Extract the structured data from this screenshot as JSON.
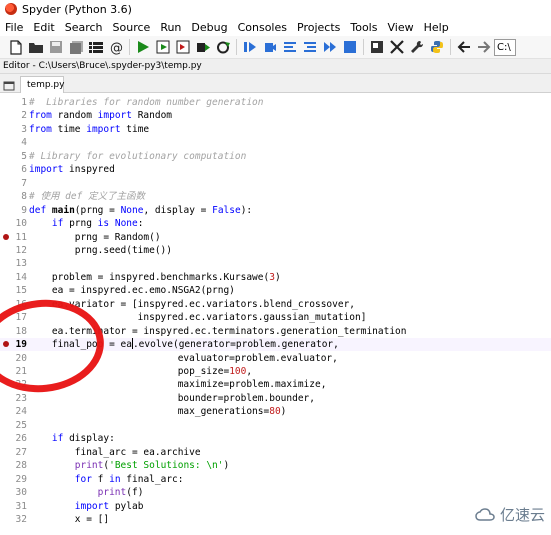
{
  "window": {
    "title": "Spyder (Python 3.6)"
  },
  "menu": [
    "File",
    "Edit",
    "Search",
    "Source",
    "Run",
    "Debug",
    "Consoles",
    "Projects",
    "Tools",
    "View",
    "Help"
  ],
  "toolbar": {
    "path_text": "C:\\"
  },
  "editor": {
    "label": "Editor - C:\\Users\\Bruce\\.spyder-py3\\temp.py",
    "tab_name": "temp.py",
    "current_line": 19,
    "lines": [
      {
        "n": "1",
        "text": "#  Libraries for random number generation"
      },
      {
        "n": "2",
        "text": "from random import Random"
      },
      {
        "n": "3",
        "text": "from time import time"
      },
      {
        "n": "4",
        "text": ""
      },
      {
        "n": "5",
        "text": "# Library for evolutionary computation"
      },
      {
        "n": "6",
        "text": "import inspyred"
      },
      {
        "n": "7",
        "text": ""
      },
      {
        "n": "8",
        "text": "# 使用 def 定义了主函数"
      },
      {
        "n": "9",
        "text": "def main(prng = None, display = False):"
      },
      {
        "n": "10",
        "text": "    if prng is None:"
      },
      {
        "n": "11",
        "text": "        prng = Random()",
        "bp": true
      },
      {
        "n": "12",
        "text": "        prng.seed(time())"
      },
      {
        "n": "13",
        "text": ""
      },
      {
        "n": "14",
        "text": "    problem = inspyred.benchmarks.Kursawe(3)"
      },
      {
        "n": "15",
        "text": "    ea = inspyred.ec.emo.NSGA2(prng)"
      },
      {
        "n": "16",
        "text": "    ea.variator = [inspyred.ec.variators.blend_crossover,"
      },
      {
        "n": "17",
        "text": "                   inspyred.ec.variators.gaussian_mutation]"
      },
      {
        "n": "18",
        "text": "    ea.terminator = inspyred.ec.terminators.generation_termination"
      },
      {
        "n": "19",
        "text": "    final_pop = ea.evolve(generator=problem.generator,",
        "bp": true
      },
      {
        "n": "20",
        "text": "                          evaluator=problem.evaluator,"
      },
      {
        "n": "21",
        "text": "                          pop_size=100,"
      },
      {
        "n": "22",
        "text": "                          maximize=problem.maximize,"
      },
      {
        "n": "23",
        "text": "                          bounder=problem.bounder,"
      },
      {
        "n": "24",
        "text": "                          max_generations=80)"
      },
      {
        "n": "25",
        "text": ""
      },
      {
        "n": "26",
        "text": "    if display:"
      },
      {
        "n": "27",
        "text": "        final_arc = ea.archive"
      },
      {
        "n": "28",
        "text": "        print('Best Solutions: \\n')"
      },
      {
        "n": "29",
        "text": "        for f in final_arc:"
      },
      {
        "n": "30",
        "text": "            print(f)"
      },
      {
        "n": "31",
        "text": "        import pylab"
      },
      {
        "n": "32",
        "text": "        x = []"
      }
    ]
  },
  "watermark": {
    "text": "亿速云"
  },
  "colors": {
    "keyword": "#0000ff",
    "comment": "#a3a3a3",
    "string": "#00a000",
    "number": "#c01a1a",
    "breakpoint": "#b01414",
    "annotation_circle": "#e81414"
  }
}
